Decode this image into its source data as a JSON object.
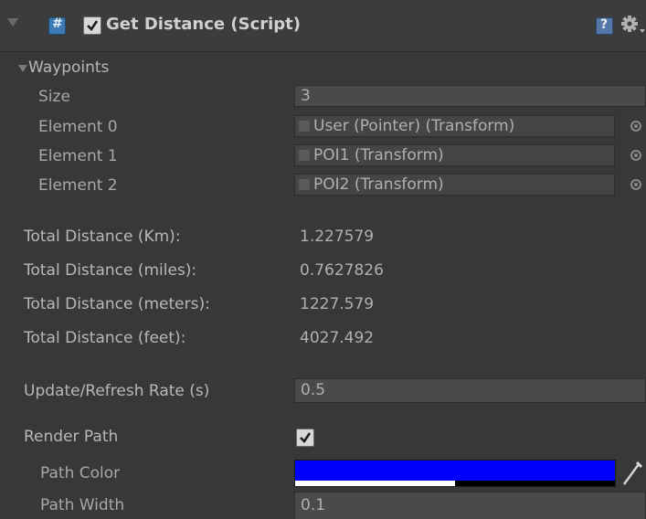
{
  "component": {
    "title": "Get Distance (Script)",
    "enabled": true
  },
  "waypoints": {
    "label": "Waypoints",
    "size_label": "Size",
    "size_value": "3",
    "elements": [
      {
        "label": "Element 0",
        "value": "User (Pointer) (Transform)"
      },
      {
        "label": "Element 1",
        "value": "POI1 (Transform)"
      },
      {
        "label": "Element 2",
        "value": "POI2 (Transform)"
      }
    ]
  },
  "distances": [
    {
      "label": "Total Distance (Km):",
      "value": "1.227579"
    },
    {
      "label": "Total Distance (miles):",
      "value": "0.7627826"
    },
    {
      "label": "Total Distance (meters):",
      "value": "1227.579"
    },
    {
      "label": "Total Distance (feet):",
      "value": "4027.492"
    }
  ],
  "refresh": {
    "label": "Update/Refresh Rate (s)",
    "value": "0.5"
  },
  "render_path": {
    "label": "Render Path",
    "checked": true,
    "color_label": "Path Color",
    "color": "#0000ff",
    "alpha": 0.5,
    "width_label": "Path Width",
    "width_value": "0.1"
  }
}
